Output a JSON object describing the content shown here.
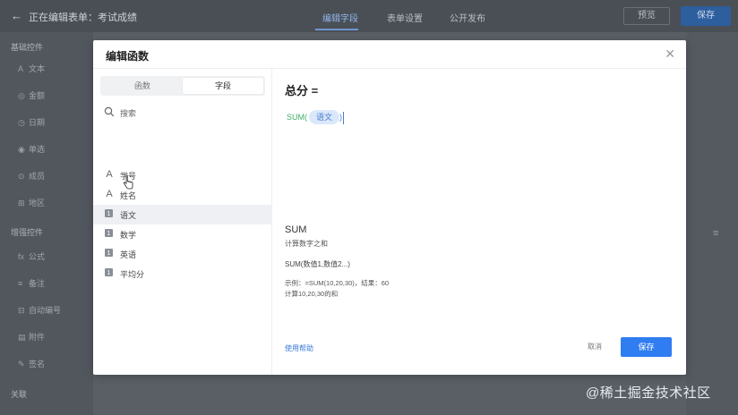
{
  "app": {
    "title": "正在编辑表单：考试成绩",
    "back_icon": "arrow-left-icon",
    "tabs": [
      {
        "label": "编辑字段",
        "active": true
      },
      {
        "label": "表单设置",
        "active": false
      },
      {
        "label": "公开发布",
        "active": false
      }
    ],
    "preview_label": "预览",
    "save_label": "保存"
  },
  "sidebar": {
    "sections": [
      {
        "label": "基础控件"
      },
      {
        "label": "增强控件"
      },
      {
        "label": "关联"
      }
    ],
    "items": [
      {
        "icon": "A",
        "label": "文本"
      },
      {
        "icon": "◎",
        "label": "金额"
      },
      {
        "icon": "◷",
        "label": "日期"
      },
      {
        "icon": "◉",
        "label": "单选"
      },
      {
        "icon": "⊙",
        "label": "成员"
      },
      {
        "icon": "⊞",
        "label": "地区"
      },
      {
        "icon": "fx",
        "label": "公式"
      },
      {
        "icon": "≡",
        "label": "备注"
      },
      {
        "icon": "⊟",
        "label": "自动编号"
      },
      {
        "icon": "▤",
        "label": "附件"
      },
      {
        "icon": "✎",
        "label": "签名"
      }
    ]
  },
  "modal": {
    "title": "编辑函数",
    "close_icon": "close-icon",
    "segments": [
      {
        "label": "函数",
        "active": false
      },
      {
        "label": "字段",
        "active": true
      }
    ],
    "search": {
      "placeholder": "搜索",
      "value": ""
    },
    "fields": [
      {
        "type": "text",
        "icon": "A",
        "label": "学号"
      },
      {
        "type": "text",
        "icon": "A",
        "label": "姓名"
      },
      {
        "type": "number",
        "icon": "1",
        "label": "语文",
        "hover": true
      },
      {
        "type": "number",
        "icon": "1",
        "label": "数学"
      },
      {
        "type": "number",
        "icon": "1",
        "label": "英语"
      },
      {
        "type": "number",
        "icon": "1",
        "label": "平均分"
      }
    ],
    "formula": {
      "target": "总分 =",
      "function": "SUM(",
      "chip": "语文",
      "close": ")"
    },
    "help": {
      "fn": "SUM",
      "desc": "计算数字之和",
      "syntax": "SUM(数值1,数值2...)",
      "example_line1": "示例：=SUM(10,20,30)，结果：60",
      "example_line2": "计算10,20,30的和"
    },
    "help_link": "使用帮助",
    "cancel_label": "取消",
    "save_label": "保存"
  },
  "watermark": "@稀土掘金技术社区",
  "colors": {
    "primary": "#2f7df0",
    "chip_bg": "#dbe8fb",
    "function_green": "#3fae6a"
  }
}
